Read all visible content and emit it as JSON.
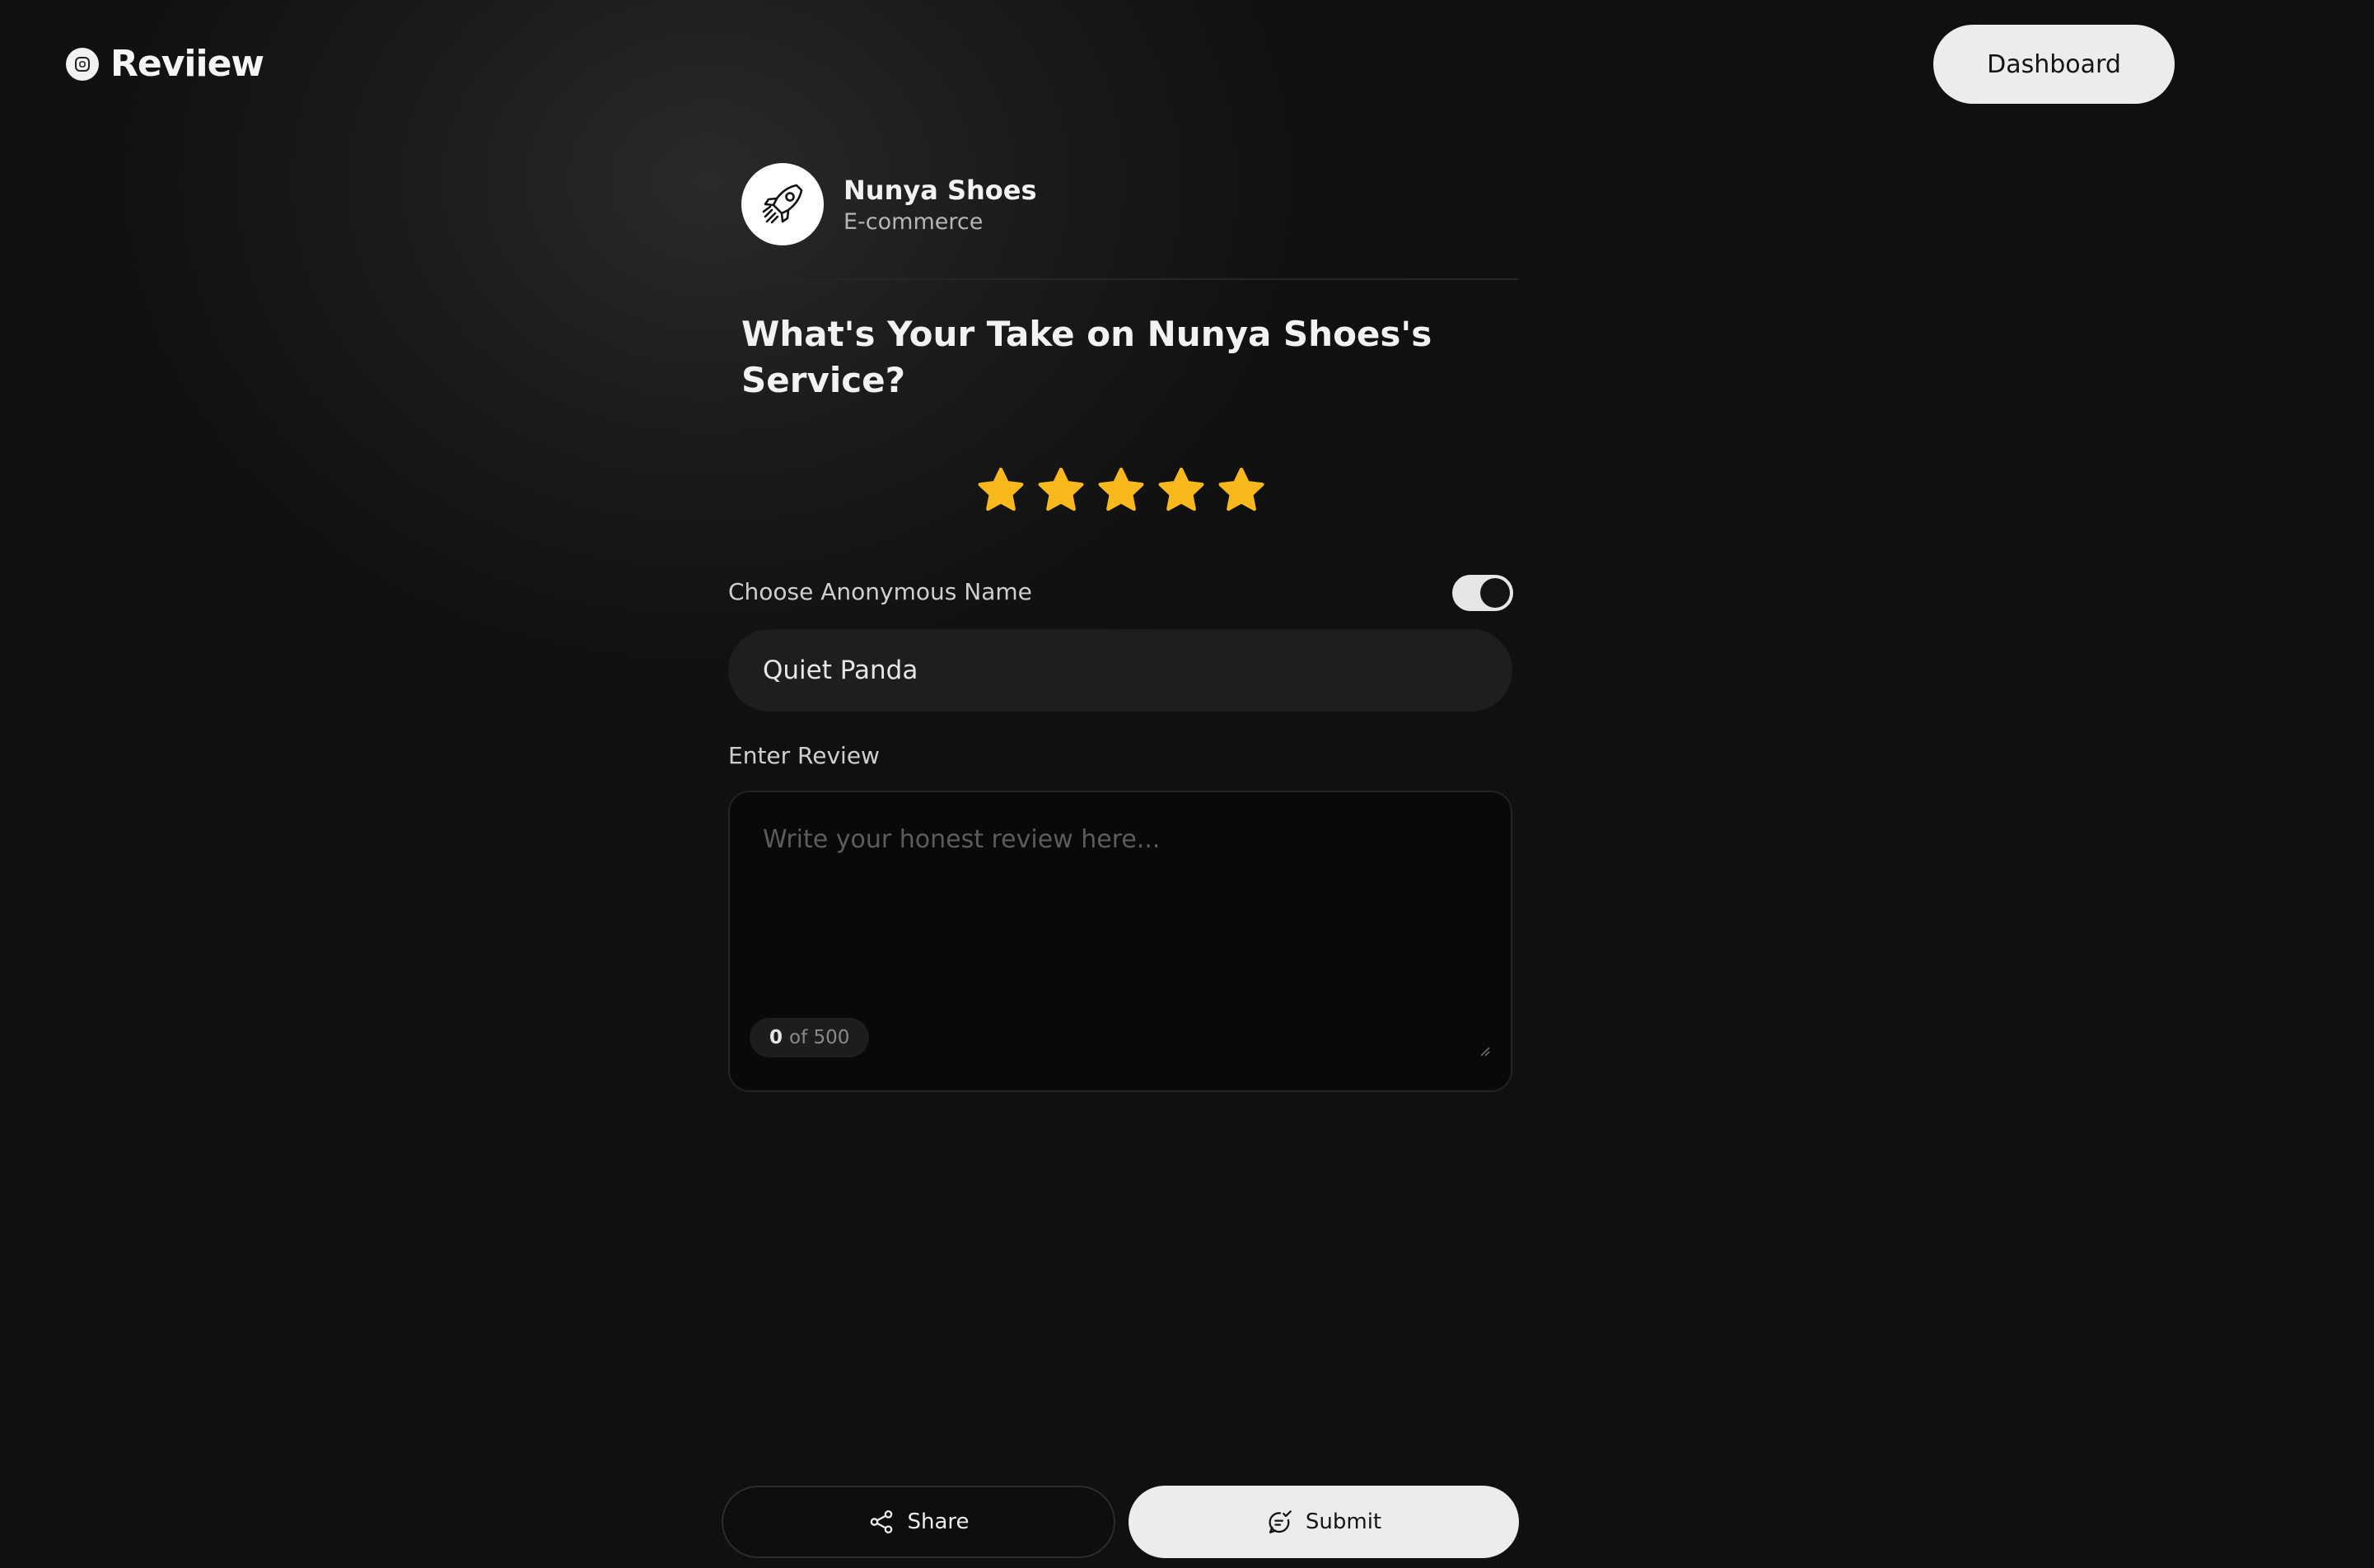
{
  "app": {
    "logo_text": "Reviiew",
    "logo_icon": "square-logo-icon"
  },
  "header": {
    "dashboard_label": "Dashboard"
  },
  "company": {
    "name": "Nunya Shoes",
    "category": "E-commerce",
    "avatar_icon": "rocket-icon"
  },
  "form": {
    "title": "What's Your Take on Nunya Shoes's Service?",
    "rating": {
      "value": 5,
      "max": 5,
      "color": "#f9b91d"
    },
    "anonymous_label": "Choose Anonymous Name",
    "anonymous_enabled": true,
    "anonymous_name_value": "Quiet Panda",
    "review_label": "Enter Review",
    "review_placeholder": "Write your honest review here...",
    "review_value": "",
    "char_count": "0",
    "char_limit_text": "of 500"
  },
  "actions": {
    "share_label": "Share",
    "share_icon": "share-icon",
    "submit_label": "Submit",
    "submit_icon": "chat-check-icon"
  }
}
